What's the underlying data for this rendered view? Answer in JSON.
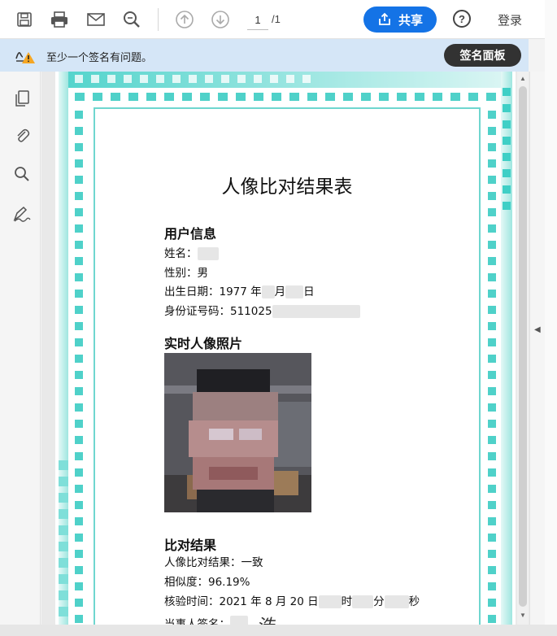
{
  "toolbar": {
    "page_current": "1",
    "page_total": "/1",
    "share_label": "共享",
    "help_label": "?",
    "login_label": "登录"
  },
  "signature_bar": {
    "warning_text": "至少一个签名有问题。",
    "panel_button": "签名面板"
  },
  "document": {
    "title": "人像比对结果表",
    "user_info": {
      "heading": "用户信息",
      "name_label": "姓名：",
      "gender_label": "性别：男",
      "birth_label": "出生日期：1977 年",
      "birth_mid": "月",
      "birth_end": "日",
      "id_label": "身份证号码：511025"
    },
    "photo": {
      "heading": "实时人像照片"
    },
    "result": {
      "heading": "比对结果",
      "match_label": "人像比对结果：一致",
      "similarity_label": "相似度：96.19%",
      "time_label": "核验时间：2021 年 8 月 20 日",
      "time_hour": "时",
      "time_min": "分",
      "time_sec": "秒",
      "signer_label": "当事人签名：",
      "signature_glyph": "浩"
    }
  },
  "colors": {
    "accent": "#1473e6",
    "teal": "#4fd1c9",
    "dark_button": "#323232",
    "warning_bar": "#d5e6f7"
  },
  "icons": [
    "save-icon",
    "print-icon",
    "mail-icon",
    "zoom-search-icon",
    "arrow-up-icon",
    "arrow-down-icon",
    "share-icon",
    "help-icon",
    "signature-warning-icon",
    "pages-icon",
    "attachment-icon",
    "search-icon",
    "fill-sign-icon"
  ]
}
